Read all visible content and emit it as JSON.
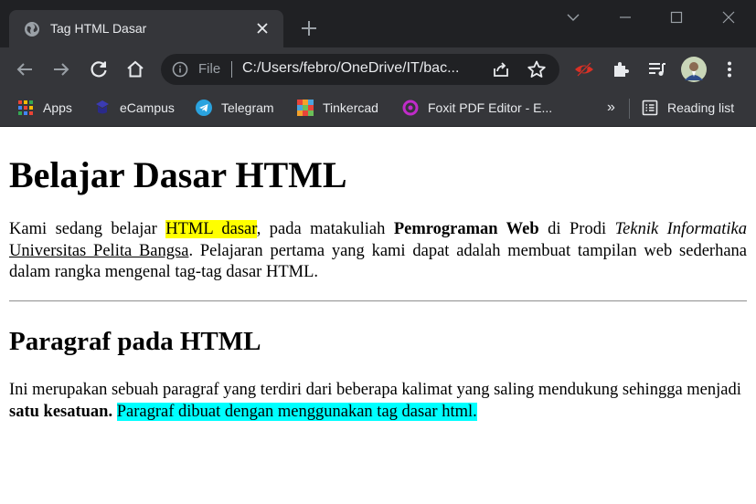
{
  "tab": {
    "title": "Tag HTML Dasar",
    "close_icon": "close-icon",
    "favicon": "globe-icon"
  },
  "window": {
    "controls": [
      "tab-search-icon",
      "minimize-icon",
      "maximize-icon",
      "close-window-icon"
    ]
  },
  "toolbar": {
    "buttons": [
      "back-icon",
      "forward-icon",
      "reload-icon",
      "home-icon"
    ],
    "omnibox": {
      "scheme_label": "File",
      "url": "C:/Users/febro/OneDrive/IT/backend/...",
      "url_display": "C:/Users/febro/OneDrive/IT/bac..."
    },
    "extensions": [
      "eye-extension-icon",
      "puzzle-icon",
      "media-queue-icon",
      "profile-avatar",
      "menu-icon"
    ]
  },
  "bookmarks": {
    "items": [
      {
        "label": "Apps",
        "icon": "apps-grid-icon"
      },
      {
        "label": "eCampus",
        "icon": "ecampus-icon"
      },
      {
        "label": "Telegram",
        "icon": "telegram-icon"
      },
      {
        "label": "Tinkercad",
        "icon": "tinkercad-icon"
      },
      {
        "label": "Foxit PDF Editor - E...",
        "icon": "foxit-icon"
      }
    ],
    "overflow": "»",
    "reading_list": "Reading list"
  },
  "page": {
    "h1": "Belajar Dasar HTML",
    "p1": {
      "t1": "Kami sedang belajar ",
      "highlight": "HTML dasar",
      "t2": ", pada matakuliah ",
      "bold": "Pemrograman Web",
      "t3": " di Prodi ",
      "italic": "Teknik Informatika",
      "t4": " ",
      "underline": "Universitas Pelita Bangsa",
      "t5": ". Pelajaran pertama yang kami dapat adalah membuat tampilan web sederhana dalam rangka mengenal tag-tag dasar HTML."
    },
    "h2": "Paragraf pada HTML",
    "p2": {
      "t1": "Ini merupakan sebuah paragraf yang terdiri dari beberapa kalimat yang saling mendukung sehingga menjadi ",
      "bold": "satu kesatuan.",
      "t2": " ",
      "highlight": "Paragraf dibuat dengan menggunakan tag dasar html."
    }
  },
  "colors": {
    "titlebar": "#202124",
    "toolbar": "#35363a",
    "highlight_yellow": "#ffff00",
    "highlight_cyan": "#00ffff"
  }
}
